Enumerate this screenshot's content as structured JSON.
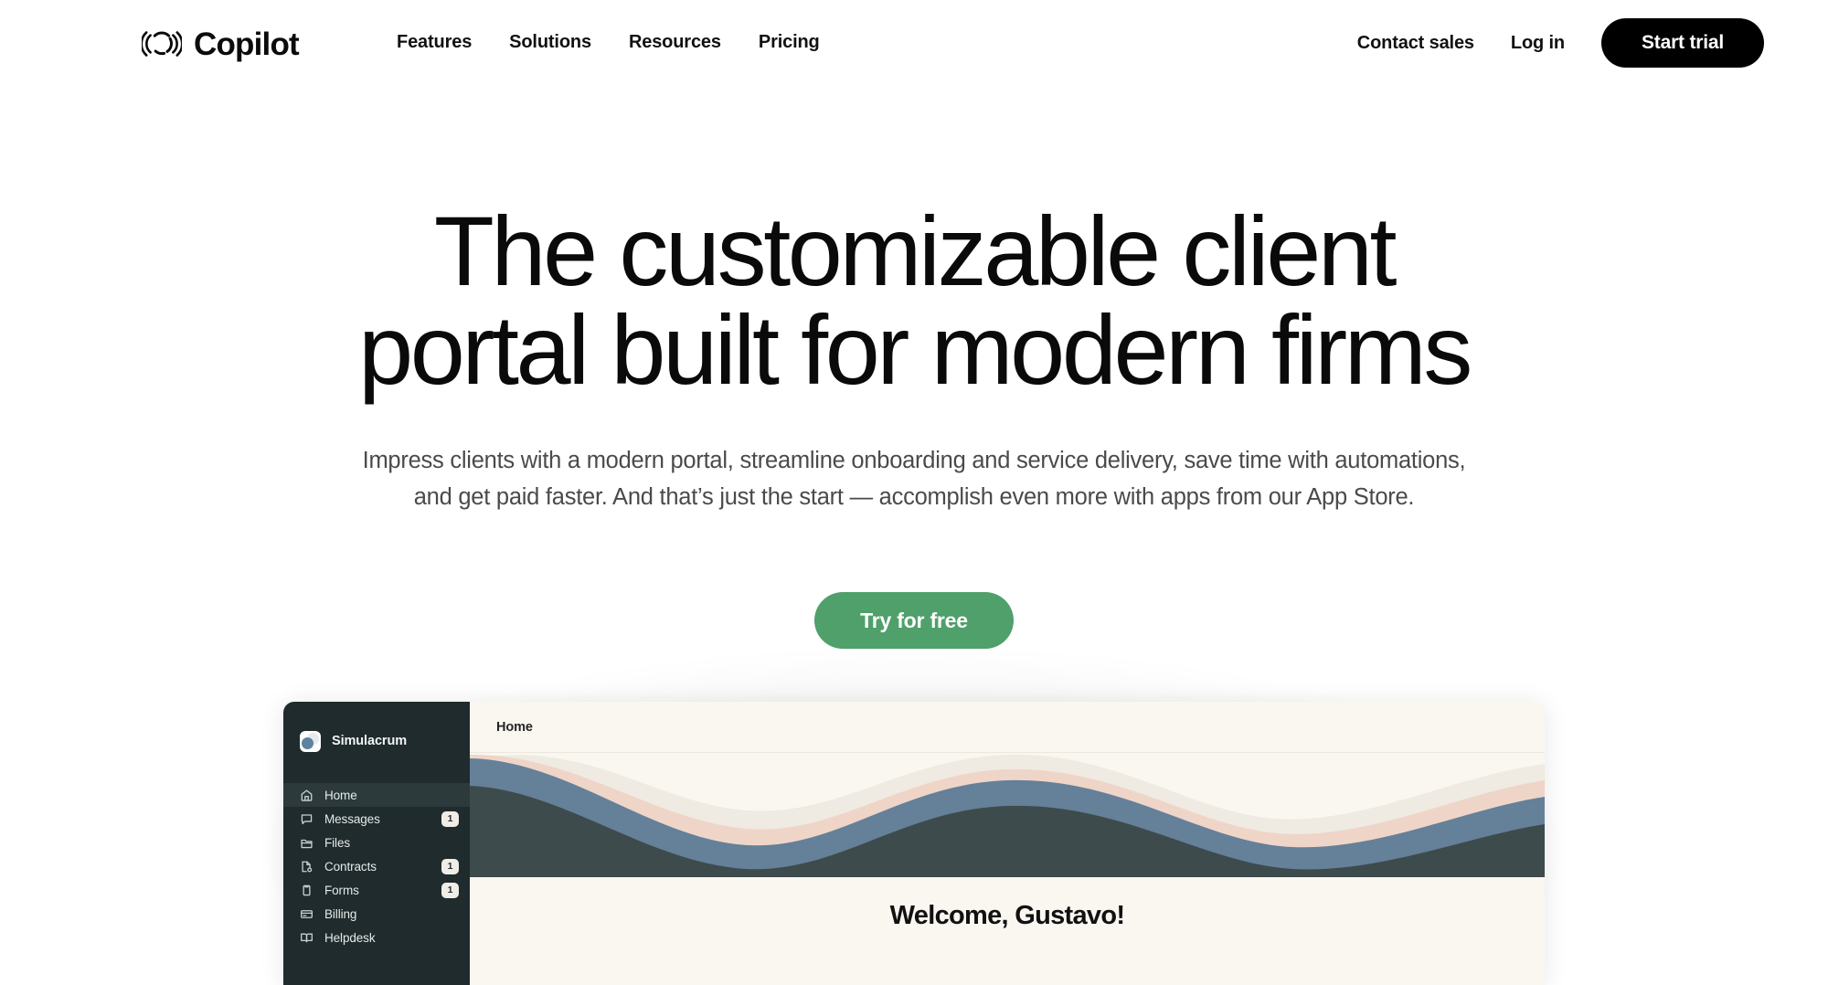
{
  "header": {
    "brand": {
      "name": "Copilot",
      "mark_icon": "copilot-circle-mark"
    },
    "nav": [
      {
        "label": "Features"
      },
      {
        "label": "Solutions"
      },
      {
        "label": "Resources"
      },
      {
        "label": "Pricing"
      }
    ],
    "actions": {
      "contact_sales": "Contact sales",
      "login": "Log in",
      "start_trial": "Start trial"
    }
  },
  "hero": {
    "title_line1": "The customizable client",
    "title_line2": "portal built for modern firms",
    "subtitle": "Impress clients with a modern portal, streamline onboarding and service delivery, save time with automations, and get paid faster. And that’s just the start — accomplish even more with apps from our App Store.",
    "cta_label": "Try for free",
    "cta_color": "#4FA06B"
  },
  "mockup": {
    "sidebar": {
      "workspace": {
        "name": "Simulacrum",
        "avatar_icon": "workspace-avatar"
      },
      "items": [
        {
          "label": "Home",
          "icon": "home-icon",
          "badge": "",
          "active": true
        },
        {
          "label": "Messages",
          "icon": "message-icon",
          "badge": "1",
          "active": false
        },
        {
          "label": "Files",
          "icon": "folder-icon",
          "badge": "",
          "active": false
        },
        {
          "label": "Contracts",
          "icon": "contract-icon",
          "badge": "1",
          "active": false
        },
        {
          "label": "Forms",
          "icon": "clipboard-icon",
          "badge": "1",
          "active": false
        },
        {
          "label": "Billing",
          "icon": "card-icon",
          "badge": "",
          "active": false
        },
        {
          "label": "Helpdesk",
          "icon": "book-icon",
          "badge": "",
          "active": false
        }
      ]
    },
    "main": {
      "breadcrumb": "Home",
      "welcome": "Welcome, Gustavo!",
      "banner_colors": {
        "background": "#FAF7F1",
        "layer_cream": "#EFEBE2",
        "layer_peach": "#EFD5C8",
        "layer_blue": "#658099",
        "layer_slate": "#3E4B4D"
      }
    }
  }
}
